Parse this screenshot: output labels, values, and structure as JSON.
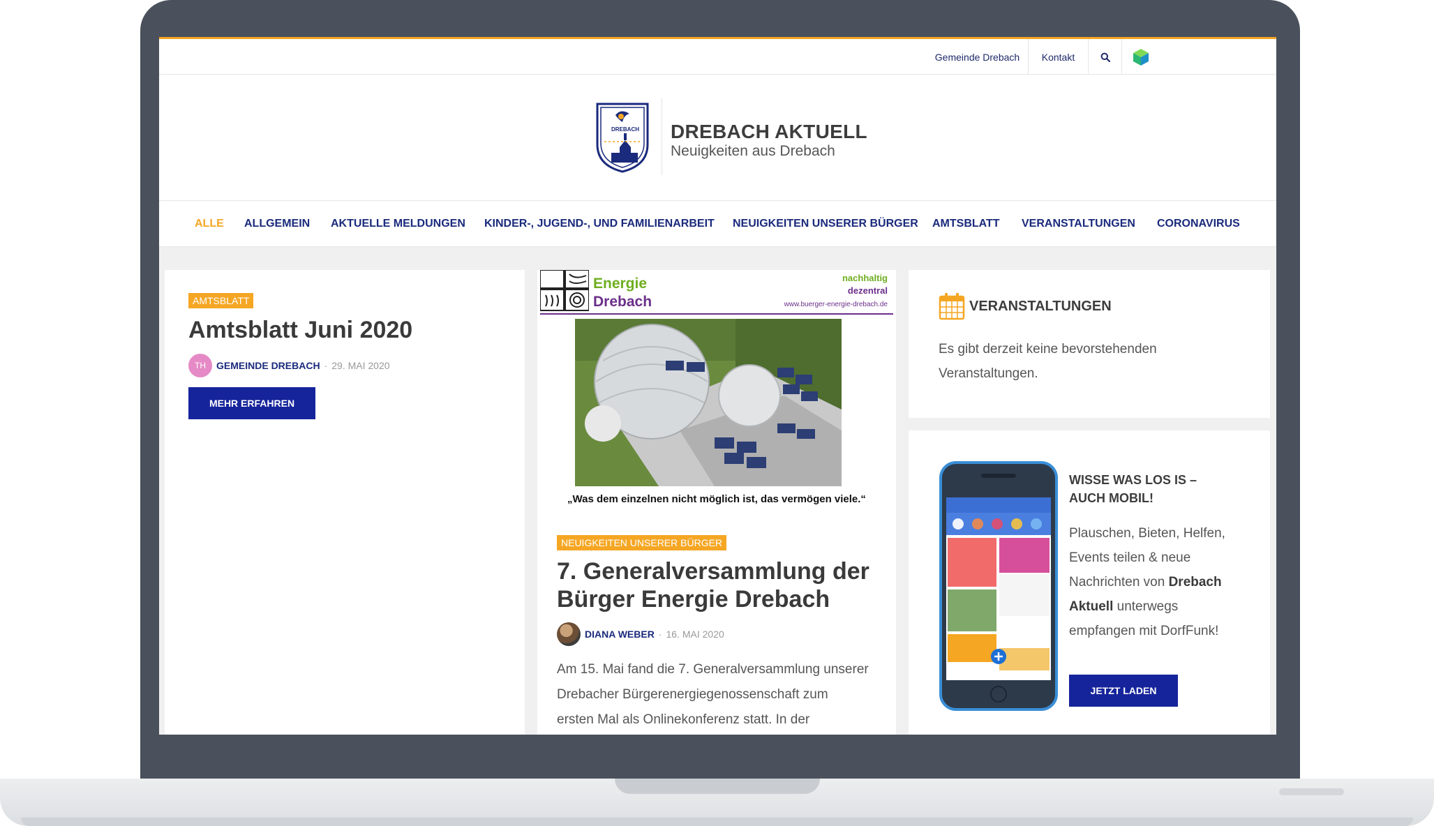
{
  "topbar": {
    "links": [
      {
        "label": "Gemeinde Drebach"
      },
      {
        "label": "Kontakt"
      }
    ],
    "search_icon": "search-icon",
    "cube_icon": "cube-icon"
  },
  "header": {
    "title": "DREBACH AKTUELL",
    "tagline": "Neuigkeiten aus Drebach",
    "logo_text": "DREBACH"
  },
  "nav": {
    "items": [
      {
        "label": "ALLE",
        "active": true
      },
      {
        "label": "ALLGEMEIN"
      },
      {
        "label": "AKTUELLE MELDUNGEN"
      },
      {
        "label": "KINDER-, JUGEND-, UND FAMILIENARBEIT"
      },
      {
        "label": "NEUIGKEITEN UNSERER BÜRGER"
      },
      {
        "label": "AMTSBLATT"
      },
      {
        "label": "VERANSTALTUNGEN"
      },
      {
        "label": "CORONAVIRUS"
      }
    ]
  },
  "posts": [
    {
      "category": "AMTSBLATT",
      "title": "Amtsblatt Juni 2020",
      "avatar_initials": "TH",
      "author": "GEMEINDE DREBACH",
      "date": "29. MAI 2020",
      "button": "MEHR ERFAHREN"
    },
    {
      "category": "NEUIGKEITEN UNSERER BÜRGER",
      "title_line1": "7. Generalversammlung der",
      "title_line2": "Bürger Energie Drebach",
      "author": "DIANA WEBER",
      "date": "16. MAI 2020",
      "excerpt_lines": [
        "Am 15. Mai fand die 7. Generalversammlung unserer",
        "Drebacher Bürgerenergiegenossenschaft zum",
        "ersten Mal als Onlinekonferenz statt. In der"
      ],
      "image": {
        "brand_line1": "Energie",
        "brand_line2": "Drebach",
        "tag1": "nachhaltig",
        "tag2": "dezentral",
        "url": "www.buerger-energie-drebach.de",
        "quote": "„Was dem einzelnen nicht möglich ist, das vermögen viele.“"
      }
    }
  ],
  "widgets": {
    "events": {
      "title": "VERANSTALTUNGEN",
      "text_line1": "Es gibt derzeit keine bevorstehenden",
      "text_line2": "Veranstaltungen."
    },
    "mobile": {
      "title_line1": "WISSE WAS LOS IS –",
      "title_line2": "AUCH MOBIL!",
      "text_line1": "Plauschen, Bieten, Helfen,",
      "text_line2": "Events teilen & neue",
      "text_line3a": "Nachrichten von ",
      "text_line3b": "Drebach",
      "text_line4a": "Aktuell",
      "text_line4b": " unterwegs",
      "text_line5": "empfangen mit DorfFunk!",
      "button": "JETZT LADEN"
    }
  },
  "colors": {
    "accent": "#f5a623",
    "primary": "#16249b",
    "nav": "#1a2a7c"
  }
}
